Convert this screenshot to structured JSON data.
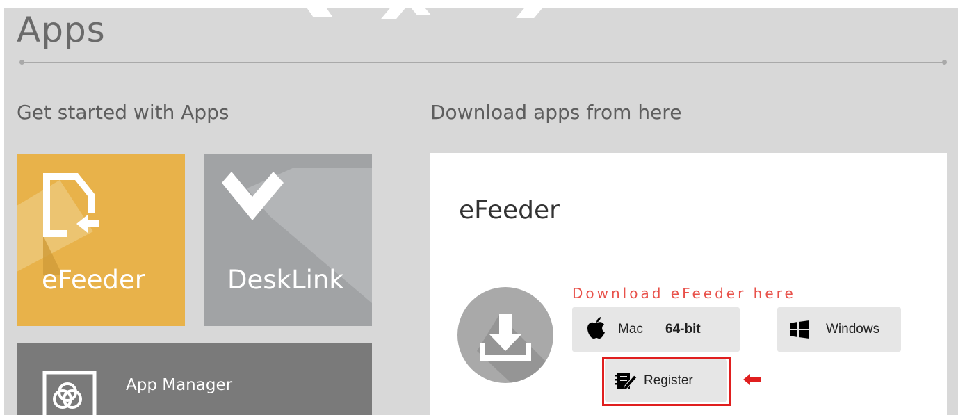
{
  "page": {
    "title": "Apps"
  },
  "left": {
    "heading": "Get started with Apps",
    "tiles": [
      {
        "label": "eFeeder",
        "icon": "efeeder-icon",
        "color": "#e8b24a"
      },
      {
        "label": "DeskLink",
        "icon": "desklink-icon",
        "color": "#a1a3a5"
      },
      {
        "label": "App Manager",
        "icon": "app-manager-icon",
        "color": "#7a7a7a"
      }
    ]
  },
  "right": {
    "heading": "Download apps from here",
    "card": {
      "title": "eFeeder",
      "download_label": "Download eFeeder here",
      "buttons": {
        "mac": {
          "label": "Mac",
          "bits": "64-bit",
          "icon": "apple-icon"
        },
        "windows": {
          "label": "Windows",
          "icon": "windows-icon"
        },
        "register": {
          "label": "Register",
          "icon": "register-icon"
        }
      }
    }
  },
  "colors": {
    "accent_red": "#e01f1f",
    "download_text": "#e8514a"
  }
}
